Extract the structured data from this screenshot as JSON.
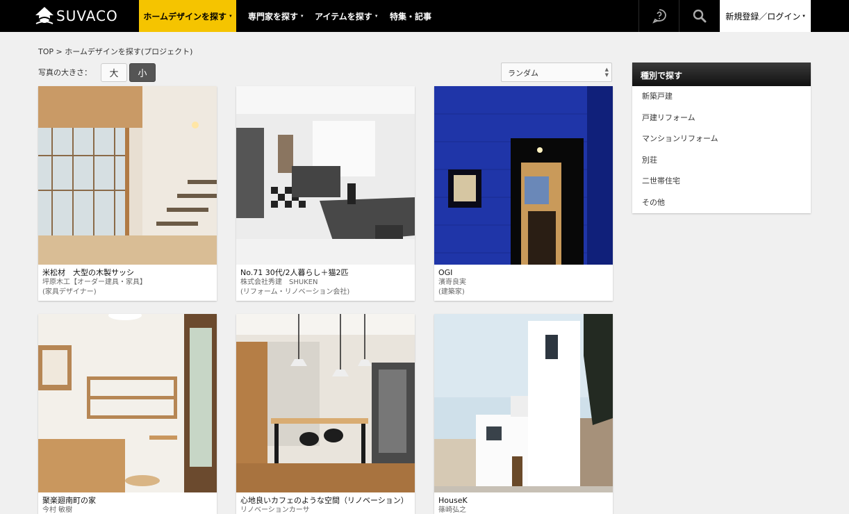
{
  "header": {
    "logo_text": "SUVACO",
    "nav": [
      {
        "label": "ホームデザインを探す",
        "active": true
      },
      {
        "label": "専門家を探す"
      },
      {
        "label": "アイテムを探す"
      },
      {
        "label": "特集・記事"
      }
    ],
    "caret": "▾",
    "login_label": "新規登録／ログイン",
    "icons": [
      "help-icon",
      "search-icon"
    ],
    "accent_color": "#f5c400"
  },
  "breadcrumb": "TOP > ホームデザインを探す(プロジェクト)",
  "photo_size": {
    "label": "写真の大きさ：",
    "options": [
      "大",
      "小"
    ],
    "selected": "小"
  },
  "sort": {
    "selected": "ランダム"
  },
  "projects": [
    {
      "title": "米松材　大型の木製サッシ",
      "company": "坪原木工【オーダー建具・家具】",
      "role": "(家具デザイナー)"
    },
    {
      "title": "No.71 30代/2人暮らし＋猫2匹",
      "company": "株式会社秀建　SHUKEN",
      "role": "(リフォーム・リノベーション会社)"
    },
    {
      "title": "OGI",
      "company": "濱嵜良実",
      "role": "(建築家)"
    },
    {
      "title": "聚楽廻南町の家",
      "company": "今村 敏樹",
      "role": ""
    },
    {
      "title": "心地良いカフェのような空間（リノベーション）",
      "company": "リノベーションカーサ",
      "role": ""
    },
    {
      "title": "HouseK",
      "company": "篠崎弘之",
      "role": ""
    }
  ],
  "sidebar": {
    "title": "種別で探す",
    "items": [
      "新築戸建",
      "戸建リフォーム",
      "マンションリフォーム",
      "別荘",
      "二世帯住宅",
      "その他"
    ]
  }
}
